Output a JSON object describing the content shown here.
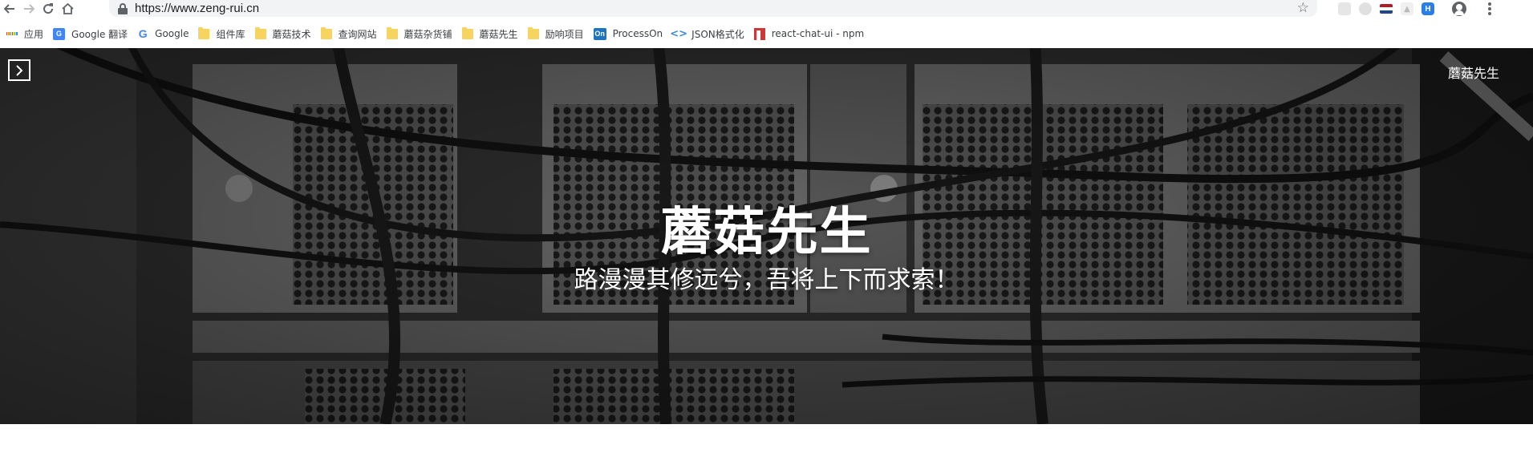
{
  "browser": {
    "url": "https://www.zeng-rui.cn",
    "nav": {
      "back_icon": "arrow-left-icon",
      "forward_icon": "arrow-right-icon",
      "reload_icon": "reload-icon",
      "home_icon": "home-icon"
    },
    "extensions": [
      "extension-gray-icon",
      "extension-circle-icon",
      "extension-flag-icon",
      "extension-light-icon",
      "extension-h-icon"
    ],
    "extension_h_label": "H"
  },
  "bookmarks": [
    {
      "label": "应用",
      "icon": "apps-grid-icon"
    },
    {
      "label": "Google 翻译",
      "icon": "google-translate-icon"
    },
    {
      "label": "Google",
      "icon": "google-icon"
    },
    {
      "label": "组件库",
      "icon": "folder-icon"
    },
    {
      "label": "蘑菇技术",
      "icon": "folder-icon"
    },
    {
      "label": "查询网站",
      "icon": "folder-icon"
    },
    {
      "label": "蘑菇杂货铺",
      "icon": "folder-icon"
    },
    {
      "label": "蘑菇先生",
      "icon": "folder-icon"
    },
    {
      "label": "励响项目",
      "icon": "folder-icon"
    },
    {
      "label": "ProcessOn",
      "icon": "processon-icon"
    },
    {
      "label": "JSON格式化",
      "icon": "json-icon"
    },
    {
      "label": "react-chat-ui - npm",
      "icon": "npm-icon"
    }
  ],
  "page": {
    "site_name": "蘑菇先生",
    "hero_title": "蘑菇先生",
    "hero_subtitle": "路漫漫其修远兮，吾将上下而求索！",
    "toggle_icon": "chevron-right-icon"
  },
  "colors": {
    "hero_bg": "#2b2b2b",
    "folder": "#f6d45f",
    "text_on_hero": "#ffffff"
  }
}
